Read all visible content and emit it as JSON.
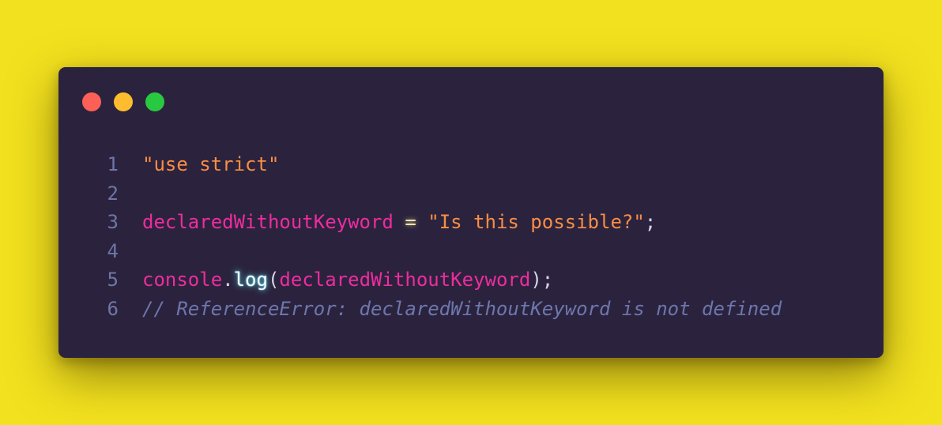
{
  "window": {
    "traffic_lights": [
      {
        "name": "close",
        "color": "#fe5f57"
      },
      {
        "name": "minimize",
        "color": "#febc2e"
      },
      {
        "name": "maximize",
        "color": "#28c840"
      }
    ]
  },
  "code": {
    "lines": [
      {
        "number": "1",
        "tokens": [
          {
            "type": "string",
            "text": "\"use strict\""
          }
        ]
      },
      {
        "number": "2",
        "tokens": []
      },
      {
        "number": "3",
        "tokens": [
          {
            "type": "variable",
            "text": "declaredWithoutKeyword"
          },
          {
            "type": "punctuation",
            "text": " "
          },
          {
            "type": "operator",
            "text": "="
          },
          {
            "type": "punctuation",
            "text": " "
          },
          {
            "type": "string",
            "text": "\"Is this possible?\""
          },
          {
            "type": "punctuation",
            "text": ";"
          }
        ]
      },
      {
        "number": "4",
        "tokens": []
      },
      {
        "number": "5",
        "tokens": [
          {
            "type": "variable",
            "text": "console"
          },
          {
            "type": "punctuation",
            "text": "."
          },
          {
            "type": "function",
            "text": "log"
          },
          {
            "type": "punctuation",
            "text": "("
          },
          {
            "type": "variable",
            "text": "declaredWithoutKeyword"
          },
          {
            "type": "punctuation",
            "text": ");"
          }
        ]
      },
      {
        "number": "6",
        "tokens": [
          {
            "type": "comment",
            "text": "// ReferenceError: declaredWithoutKeyword is not defined"
          }
        ]
      }
    ]
  },
  "colors": {
    "background": "#f2e11e",
    "window": "#2b233d",
    "line_number": "#6e76a8",
    "string": "#f98d45",
    "variable": "#ee2c9f",
    "function": "#f6fbff",
    "comment": "#6d76ad",
    "punctuation": "#d7d3e6"
  }
}
